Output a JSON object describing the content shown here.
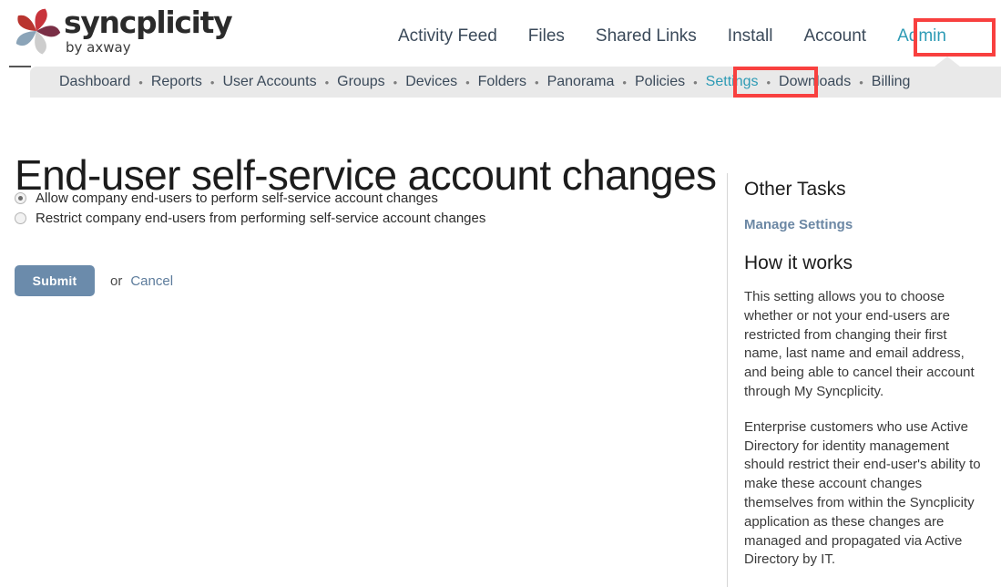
{
  "brand": {
    "name": "syncplicity",
    "tagline": "by axway",
    "logo_icon": "syncplicity-pinwheel-logo",
    "petal_colors": [
      "#c8343c",
      "#7a2f46",
      "#c9c9c9",
      "#7f9bb3",
      "#a8bcc9"
    ]
  },
  "topnav": {
    "items": [
      {
        "label": "Activity Feed",
        "active": false
      },
      {
        "label": "Files",
        "active": false
      },
      {
        "label": "Shared Links",
        "active": false
      },
      {
        "label": "Install",
        "active": false
      },
      {
        "label": "Account",
        "active": false
      },
      {
        "label": "Admin",
        "active": true
      }
    ]
  },
  "subnav": {
    "separator": "•",
    "items": [
      {
        "label": "Dashboard",
        "active": false
      },
      {
        "label": "Reports",
        "active": false
      },
      {
        "label": "User Accounts",
        "active": false
      },
      {
        "label": "Groups",
        "active": false
      },
      {
        "label": "Devices",
        "active": false
      },
      {
        "label": "Folders",
        "active": false
      },
      {
        "label": "Panorama",
        "active": false
      },
      {
        "label": "Policies",
        "active": false
      },
      {
        "label": "Settings",
        "active": true
      },
      {
        "label": "Downloads",
        "active": false
      },
      {
        "label": "Billing",
        "active": false
      }
    ]
  },
  "annotations": {
    "color": "#f8403f",
    "boxes": [
      {
        "target": "Admin"
      },
      {
        "target": "Settings"
      }
    ]
  },
  "main": {
    "title": "End-user self-service account changes",
    "options": [
      {
        "label": "Allow company end-users to perform self-service account changes",
        "selected": true
      },
      {
        "label": "Restrict company end-users from performing self-service account changes",
        "selected": false
      }
    ],
    "submit_label": "Submit",
    "or_label": "or",
    "cancel_label": "Cancel",
    "submit_color": "#6b8bab"
  },
  "sidebar": {
    "other_tasks_heading": "Other Tasks",
    "manage_settings_link": "Manage Settings",
    "how_it_works_heading": "How it works",
    "paragraphs": [
      "This setting allows you to choose whether or not your end-users are restricted from changing their first name, last name and email address, and being able to cancel their account through My Syncplicity.",
      "Enterprise customers who use Active Directory for identity management should restrict their end-user's ability to make these account changes themselves from within the Syncplicity application as these changes are managed and propagated via Active Directory by IT."
    ]
  }
}
